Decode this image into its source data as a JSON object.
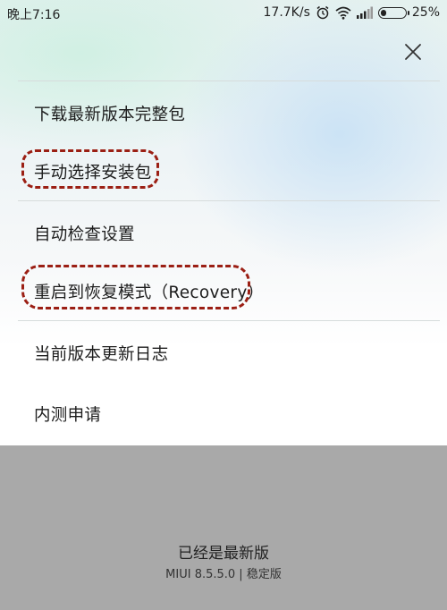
{
  "status_bar": {
    "time": "晚上7:16",
    "network_speed": "17.7K/s",
    "battery_percent_label": "25%",
    "battery_level": 0.25,
    "icons": [
      "alarm-icon",
      "wifi-icon",
      "signal-icon",
      "battery-icon"
    ]
  },
  "menu": {
    "close_icon": "close-icon",
    "items": [
      {
        "label": "下载最新版本完整包"
      },
      {
        "label": "手动选择安装包"
      },
      {
        "label": "自动检查设置"
      },
      {
        "label": "重启到恢复模式（Recovery）"
      },
      {
        "label": "当前版本更新日志"
      },
      {
        "label": "内测申请"
      }
    ]
  },
  "footer": {
    "status": "已经是最新版",
    "version": "MIUI 8.5.5.0 | 稳定版"
  },
  "colors": {
    "annotation": "#9b1f14",
    "overlay": "#a9a9a9",
    "text": "#1d1d1d"
  }
}
